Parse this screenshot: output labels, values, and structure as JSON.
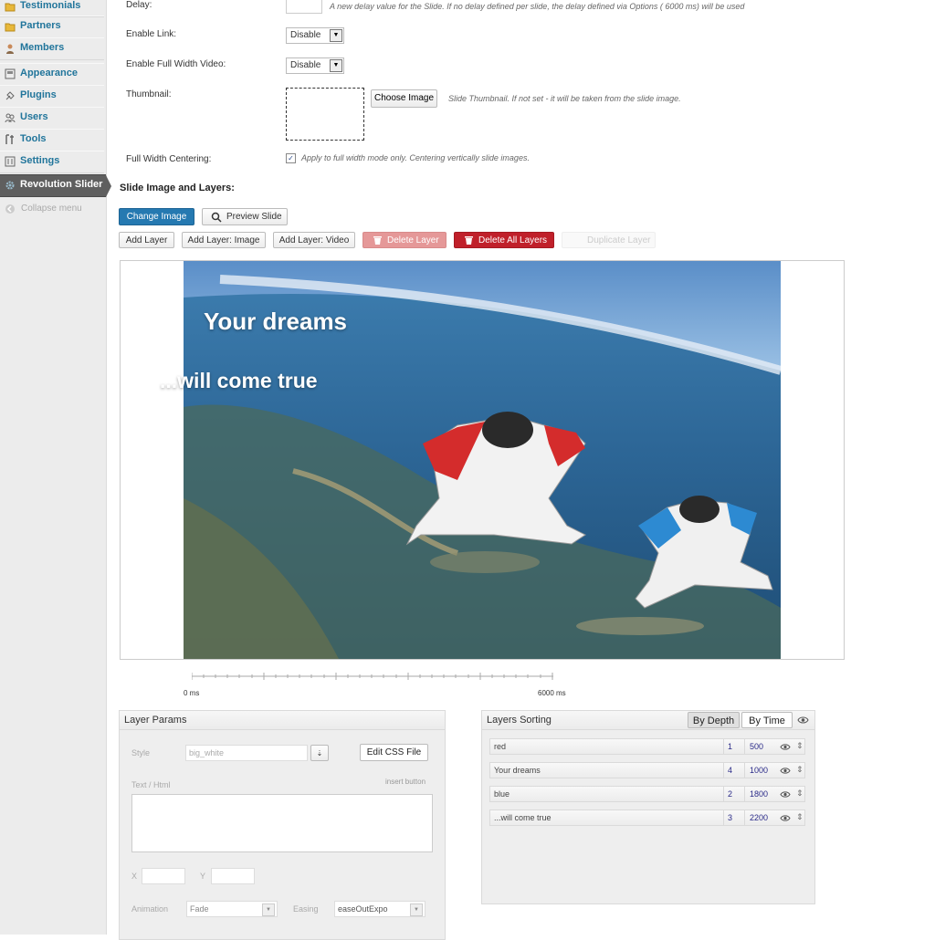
{
  "sidebar": {
    "items": [
      {
        "label": "Testimonials",
        "icon": "folder-icon"
      },
      {
        "label": "Partners",
        "icon": "folder-icon"
      },
      {
        "label": "Members",
        "icon": "person-icon"
      },
      {
        "label": "Appearance",
        "icon": "appearance-icon"
      },
      {
        "label": "Plugins",
        "icon": "plugin-icon"
      },
      {
        "label": "Users",
        "icon": "users-icon"
      },
      {
        "label": "Tools",
        "icon": "tools-icon"
      },
      {
        "label": "Settings",
        "icon": "settings-icon"
      },
      {
        "label": "Revolution Slider",
        "icon": "gear-icon",
        "active": true
      }
    ],
    "collapse_label": "Collapse menu"
  },
  "form": {
    "delay_label": "Delay:",
    "delay_help": "A new delay value for the Slide. If no delay defined per slide, the delay defined via Options ( 6000 ms) will be used",
    "enable_link_label": "Enable Link:",
    "enable_link_value": "Disable",
    "full_width_video_label": "Enable Full Width Video:",
    "full_width_video_value": "Disable",
    "thumbnail_label": "Thumbnail:",
    "choose_image_label": "Choose Image",
    "thumbnail_help": "Slide Thumbnail. If not set - it will be taken from the slide image.",
    "centering_label": "Full Width Centering:",
    "centering_checked": true,
    "centering_help": "Apply to full width mode only. Centering vertically slide images."
  },
  "layers_section": {
    "heading": "Slide Image and Layers:",
    "change_image": "Change Image",
    "preview_slide": "Preview Slide",
    "add_layer": "Add Layer",
    "add_layer_image": "Add Layer: Image",
    "add_layer_video": "Add Layer: Video",
    "delete_layer": "Delete Layer",
    "delete_all_layers": "Delete All Layers",
    "duplicate_layer": "Duplicate Layer"
  },
  "slide": {
    "caption1": "Your dreams",
    "caption2": "...will come true"
  },
  "timeline": {
    "start_label": "0 ms",
    "end_label": "6000 ms"
  },
  "layer_params": {
    "title": "Layer Params",
    "style_label": "Style",
    "style_value": "big_white",
    "edit_css": "Edit CSS File",
    "text_label": "Text / Html",
    "insert_button": "insert button",
    "x_label": "X",
    "y_label": "Y",
    "animation_label": "Animation",
    "animation_value": "Fade",
    "easing_label": "Easing",
    "easing_value": "easeOutExpo"
  },
  "layers_sorting": {
    "title": "Layers Sorting",
    "by_depth": "By Depth",
    "by_time": "By Time",
    "rows": [
      {
        "name": "red",
        "depth": "1",
        "time": "500"
      },
      {
        "name": "Your dreams",
        "depth": "4",
        "time": "1000"
      },
      {
        "name": "blue",
        "depth": "2",
        "time": "1800"
      },
      {
        "name": "...will come true",
        "depth": "3",
        "time": "2200"
      }
    ]
  },
  "colors": {
    "link": "#21759b",
    "active_menu": "#5f5f5f",
    "primary_button": "#2579b1",
    "danger_button": "#c0202a"
  }
}
